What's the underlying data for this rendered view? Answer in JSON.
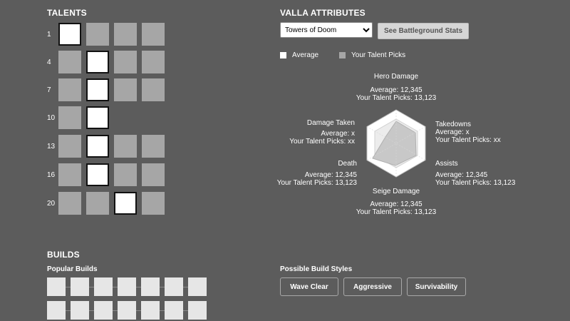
{
  "talents": {
    "title": "TALENTS",
    "rows": [
      {
        "level": "1",
        "count": 4,
        "selected": 0
      },
      {
        "level": "4",
        "count": 4,
        "selected": 1
      },
      {
        "level": "7",
        "count": 4,
        "selected": 1
      },
      {
        "level": "10",
        "count": 2,
        "selected": 1
      },
      {
        "level": "13",
        "count": 4,
        "selected": 1
      },
      {
        "level": "16",
        "count": 4,
        "selected": 1
      },
      {
        "level": "20",
        "count": 4,
        "selected": 2
      }
    ]
  },
  "attributes": {
    "title": "VALLA ATTRIBUTES",
    "map_select": {
      "value": "Towers of Doom"
    },
    "stats_button": "See Battleground Stats",
    "legend": {
      "average": "Average",
      "talent_picks": "Your Talent Picks"
    },
    "colors": {
      "average": "#ffffff",
      "talent_picks": "#a6a6a6"
    },
    "stats": {
      "hero_damage": {
        "label": "Hero Damage",
        "average": "Average: 12,345",
        "picks": "Your Talent Picks: 13,123"
      },
      "takedowns": {
        "label": "Takedowns",
        "average": "Average: x",
        "picks": "Your Talent Picks: xx"
      },
      "assists": {
        "label": "Assists",
        "average": "Average: 12,345",
        "picks": "Your Talent Picks: 13,123"
      },
      "siege_damage": {
        "label": "Seige Damage",
        "average": "Average: 12,345",
        "picks": "Your Talent Picks: 13,123"
      },
      "death": {
        "label": "Death",
        "average": "Average: 12,345",
        "picks": "Your Talent Picks: 13,123"
      },
      "damage_taken": {
        "label": "Damage Taken",
        "average": "Average: x",
        "picks": "Your Talent Picks: xx"
      }
    }
  },
  "builds": {
    "title": "BUILDS",
    "popular_label": "Popular Builds",
    "rows": [
      7,
      7
    ],
    "styles_label": "Possible Build Styles",
    "styles": [
      "Wave Clear",
      "Aggressive",
      "Survivability"
    ]
  }
}
